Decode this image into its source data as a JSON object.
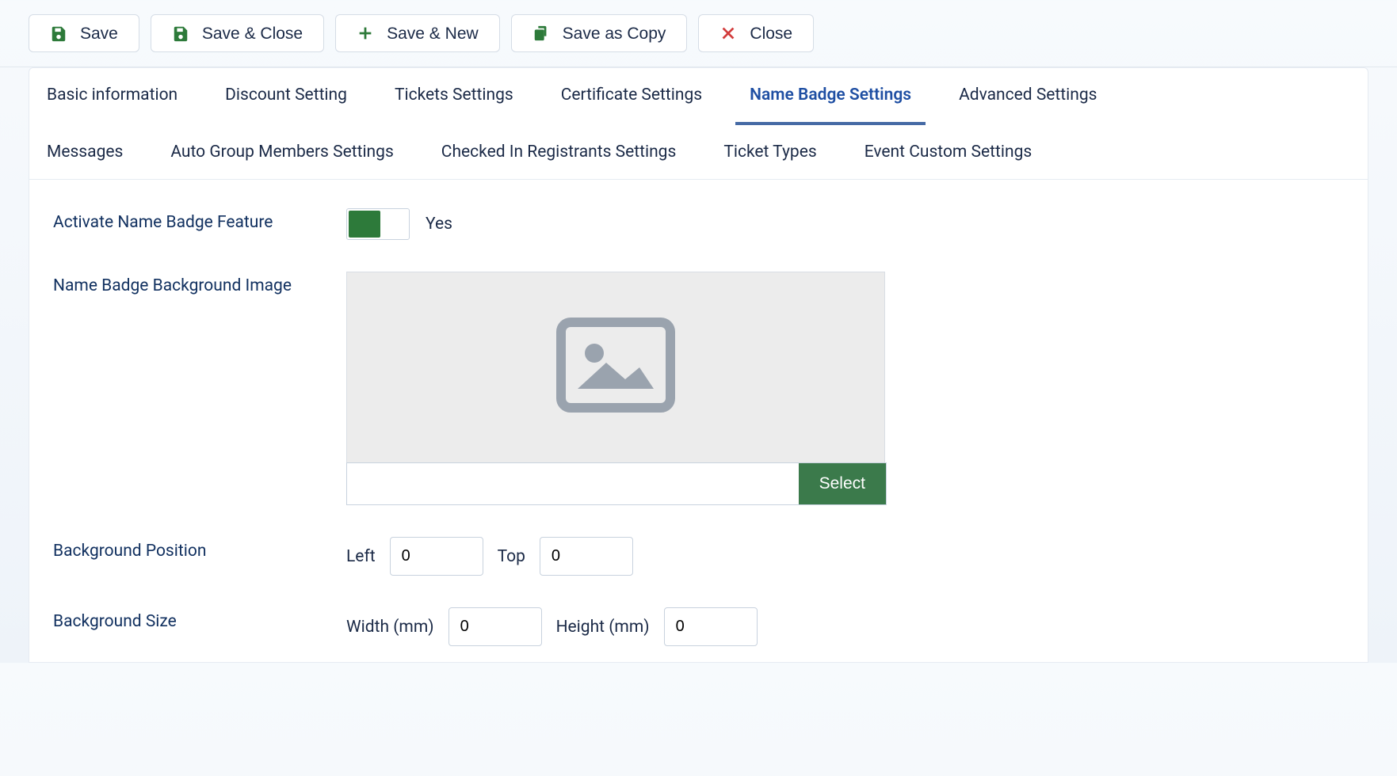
{
  "toolbar": {
    "save_label": "Save",
    "save_close_label": "Save & Close",
    "save_new_label": "Save & New",
    "save_copy_label": "Save as Copy",
    "close_label": "Close"
  },
  "tabs": [
    {
      "label": "Basic information",
      "active": false
    },
    {
      "label": "Discount Setting",
      "active": false
    },
    {
      "label": "Tickets Settings",
      "active": false
    },
    {
      "label": "Certificate Settings",
      "active": false
    },
    {
      "label": "Name Badge Settings",
      "active": true
    },
    {
      "label": "Advanced Settings",
      "active": false
    },
    {
      "label": "Messages",
      "active": false
    },
    {
      "label": "Auto Group Members Settings",
      "active": false
    },
    {
      "label": "Checked In Registrants Settings",
      "active": false
    },
    {
      "label": "Ticket Types",
      "active": false
    },
    {
      "label": "Event Custom Settings",
      "active": false
    }
  ],
  "form": {
    "activate_label": "Activate Name Badge Feature",
    "activate_value": true,
    "activate_value_text": "Yes",
    "bg_image_label": "Name Badge Background Image",
    "bg_image_path": "",
    "select_button": "Select",
    "bg_position_label": "Background Position",
    "bg_position_left_label": "Left",
    "bg_position_left_value": "0",
    "bg_position_top_label": "Top",
    "bg_position_top_value": "0",
    "bg_size_label": "Background Size",
    "bg_size_width_label": "Width (mm)",
    "bg_size_width_value": "0",
    "bg_size_height_label": "Height (mm)",
    "bg_size_height_value": "0"
  },
  "icons": {
    "save": "save-icon",
    "plus": "plus-icon",
    "copy": "copy-icon",
    "close": "close-icon",
    "image": "image-placeholder-icon"
  },
  "colors": {
    "accent_green": "#2d7a3a",
    "select_green": "#3b7a4b",
    "close_red": "#d23c3c",
    "tab_active": "#1f4fa3"
  }
}
